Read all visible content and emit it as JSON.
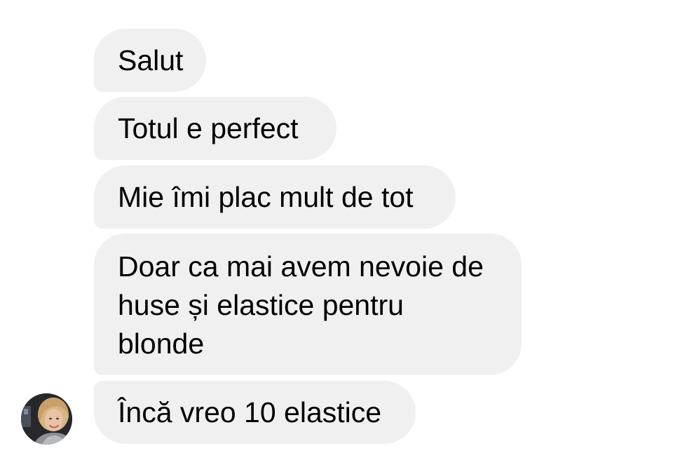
{
  "conversation": {
    "messages": [
      {
        "text": "Salut"
      },
      {
        "text": "Totul e perfect"
      },
      {
        "text": "Mie îmi plac mult de tot"
      },
      {
        "text": "Doar ca mai avem nevoie de huse și elastice pentru blonde"
      },
      {
        "text": "Încă vreo 10 elastice"
      }
    ],
    "sender_avatar": {
      "icon": "user-photo-avatar"
    }
  },
  "colors": {
    "background": "#ffffff",
    "bubble": "#f0f0f0",
    "text": "#000000"
  }
}
